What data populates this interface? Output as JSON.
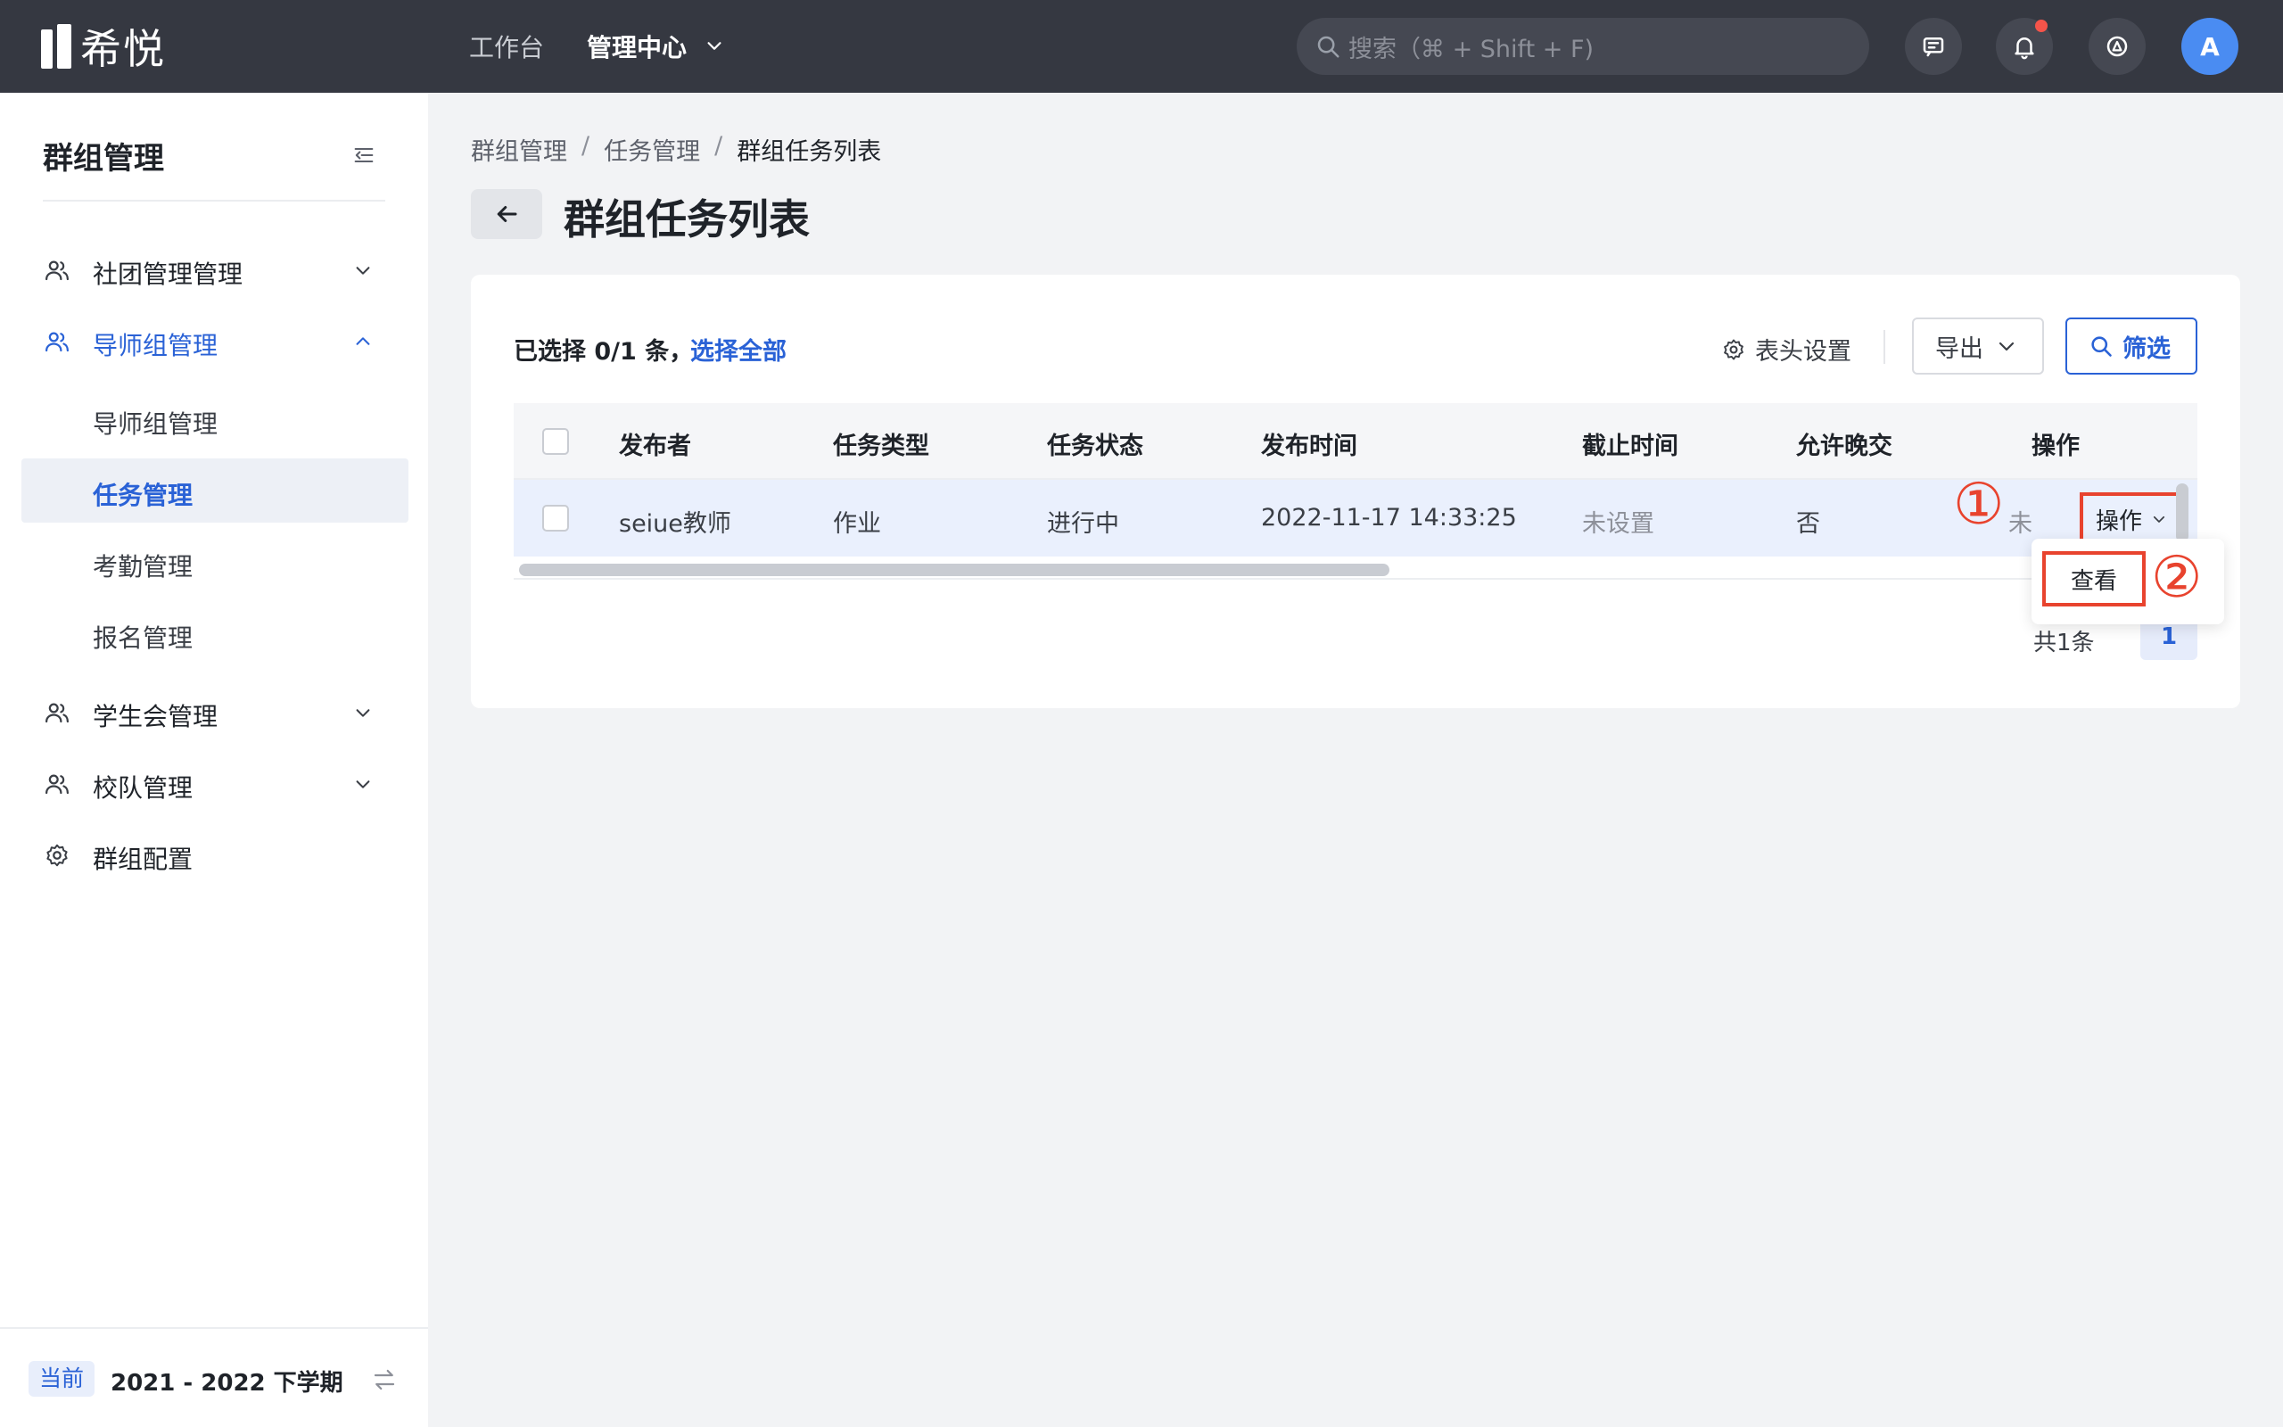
{
  "app": {
    "logo_text": "希悦"
  },
  "topnav": {
    "workbench": "工作台",
    "admin_center": "管理中心",
    "search_placeholder": "搜索（⌘ + Shift + F)",
    "avatar_letter": "A"
  },
  "sidebar": {
    "title": "群组管理",
    "items": [
      {
        "label": "社团管理管理"
      },
      {
        "label": "导师组管理"
      },
      {
        "label": "学生会管理"
      },
      {
        "label": "校队管理"
      },
      {
        "label": "群组配置"
      }
    ],
    "sub_items": [
      {
        "label": "导师组管理"
      },
      {
        "label": "任务管理"
      },
      {
        "label": "考勤管理"
      },
      {
        "label": "报名管理"
      }
    ],
    "footer": {
      "badge": "当前",
      "term": "2021 - 2022 下学期"
    }
  },
  "breadcrumb": [
    "群组管理",
    "任务管理",
    "群组任务列表"
  ],
  "page": {
    "title": "群组任务列表"
  },
  "toolbar": {
    "selection_info": "已选择 0/1 条，",
    "select_all": "选择全部",
    "header_settings": "表头设置",
    "export": "导出",
    "filter": "筛选"
  },
  "table": {
    "columns": [
      "发布者",
      "任务类型",
      "任务状态",
      "发布时间",
      "截止时间",
      "允许晚交",
      "操作"
    ],
    "rows": [
      {
        "publisher": "seiue教师",
        "type": "作业",
        "status": "进行中",
        "published_at": "2022-11-17 14:33:25",
        "deadline": "未设置",
        "late_allowed": "否",
        "hidden_partial": "未",
        "action": "操作"
      }
    ]
  },
  "pagination": {
    "total": "共1条",
    "current": "1"
  },
  "dropdown": {
    "items": [
      "查看"
    ]
  },
  "annotations": {
    "step1": "①",
    "step2": "②"
  },
  "colors": {
    "accent": "#2a62d6",
    "annotation": "#e8432e",
    "topbar": "#353841"
  }
}
